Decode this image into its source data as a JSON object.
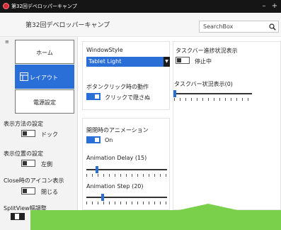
{
  "window": {
    "title": "第32回デベロッパーキャンプ",
    "minimize": "–",
    "close": "+"
  },
  "header": {
    "title": "第32回デベロッパーキャンプ",
    "search_placeholder": "SearchBox"
  },
  "nav": {
    "items": [
      {
        "label": "ホーム",
        "active": false
      },
      {
        "label": "レイアウト",
        "active": true
      },
      {
        "label": "電源設定",
        "active": false
      }
    ]
  },
  "pane_settings": {
    "display_mode": {
      "label": "表示方法の設定",
      "value": "ドック"
    },
    "position": {
      "label": "表示位置の設定",
      "value": "左側"
    },
    "close_icon": {
      "label": "Close時のアイコン表示",
      "value": "閉じる"
    },
    "splitview": {
      "label": "SplitView幅調整"
    }
  },
  "window_settings": {
    "window_style": {
      "label": "WindowStyle",
      "value": "Tablet Light"
    },
    "button_click": {
      "label": "ボタンクリック時の動作",
      "value": "クリックで隠さぬ"
    },
    "open_close_animation": {
      "label": "開閉時のアニメーション",
      "value": "On"
    },
    "animation_delay": {
      "label": "Animation Delay (15)",
      "value": 15
    },
    "animation_step": {
      "label": "Animation Step (20)",
      "value": 20
    }
  },
  "taskbar_settings": {
    "progress_label": "タスクバー進捗状況表示",
    "progress_value": "停止中",
    "status_label": "タスクバー状況表示(0)",
    "status_value": 0
  },
  "colors": {
    "accent": "#2a6ed8",
    "overlay": "#7ad04a",
    "titlebar": "#151515"
  }
}
